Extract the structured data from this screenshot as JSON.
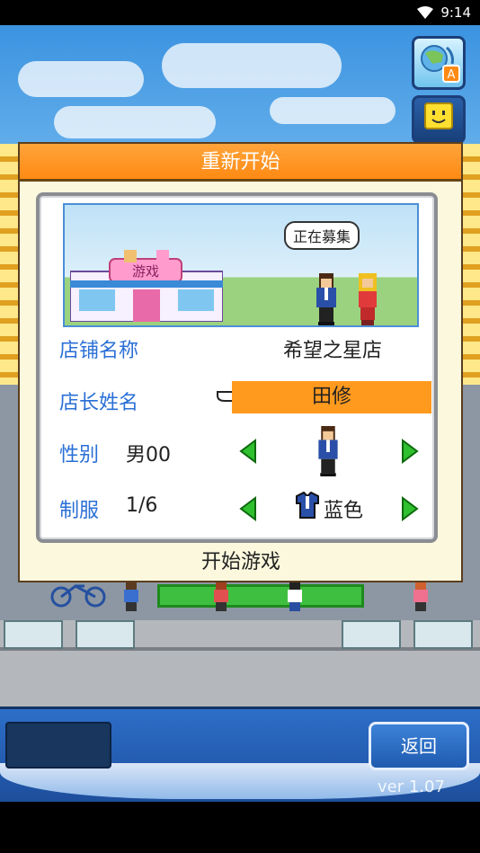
{
  "status_bar": {
    "time": "9:14",
    "wifi_icon": "wifi-icon",
    "signal_icon": "signal-icon"
  },
  "top_icons": {
    "language_button_badge": "A",
    "language_icon": "translate-icon",
    "smile_icon": "smile-face-icon"
  },
  "dialog": {
    "title": "重新开始",
    "preview": {
      "bubble": "正在募集",
      "store_sign": "游戏"
    },
    "rows": {
      "store_name": {
        "label": "店铺名称",
        "value": "希望之星店"
      },
      "manager_name": {
        "label": "店长姓名",
        "value": "田修"
      },
      "gender": {
        "label": "性别",
        "value": "男00"
      },
      "uniform": {
        "label": "制服",
        "index": "1/6",
        "color_name": "蓝色"
      }
    },
    "start_button": "开始游戏"
  },
  "bottom_bar": {
    "back_button": "返回",
    "version": "ver 1.07"
  },
  "colors": {
    "header_orange": "#ff8a14",
    "label_blue": "#2a6fd6",
    "highlight_orange": "#ff9a1e",
    "arrow_green": "#2fbf2f"
  }
}
